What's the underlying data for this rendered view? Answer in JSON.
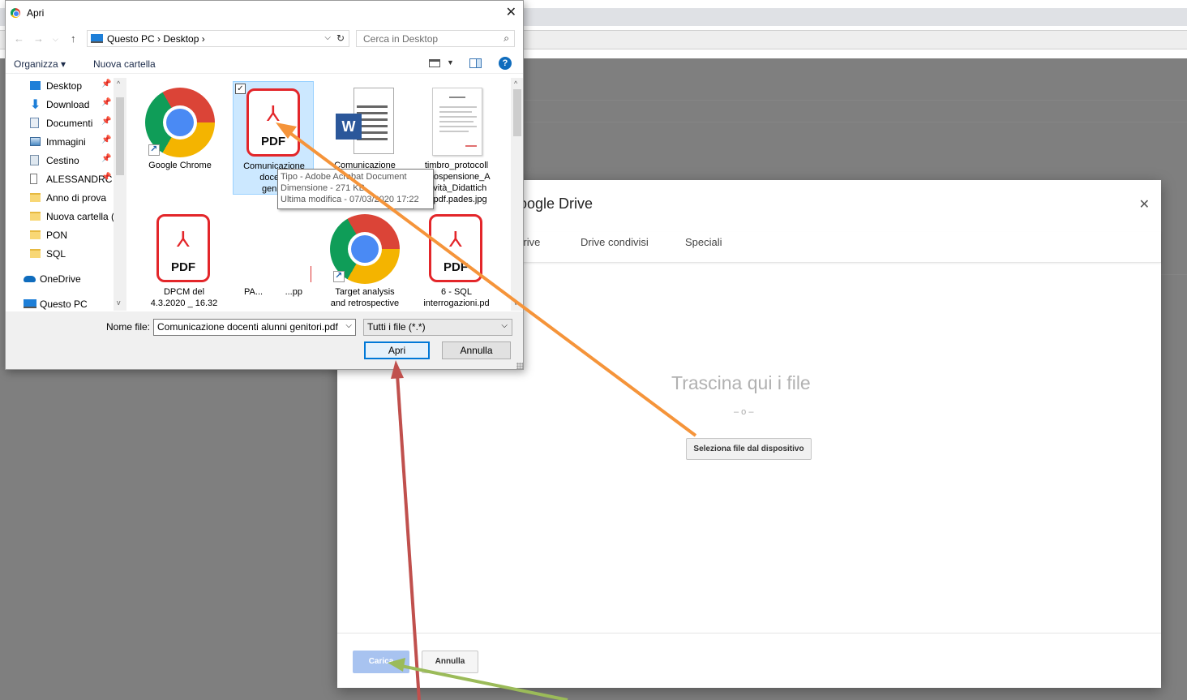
{
  "dialog": {
    "title": "Apri",
    "breadcrumb": "Questo PC  ›  Desktop  ›",
    "search_placeholder": "Cerca in Desktop",
    "toolbar": {
      "organizza": "Organizza ▾",
      "nuova_cartella": "Nuova cartella"
    },
    "nav_items": [
      {
        "label": "Desktop",
        "icon": "desktop-icon",
        "pinned": true
      },
      {
        "label": "Download",
        "icon": "download-icon",
        "pinned": true
      },
      {
        "label": "Documenti",
        "icon": "documents-icon",
        "pinned": true
      },
      {
        "label": "Immagini",
        "icon": "pictures-icon",
        "pinned": true
      },
      {
        "label": "Cestino",
        "icon": "recycle-bin-icon",
        "pinned": true
      },
      {
        "label": "ALESSANDRC",
        "icon": "file-icon",
        "pinned": true
      },
      {
        "label": "Anno di prova",
        "icon": "folder-icon",
        "pinned": false
      },
      {
        "label": "Nuova cartella (3",
        "icon": "folder-icon",
        "pinned": false
      },
      {
        "label": "PON",
        "icon": "folder-icon",
        "pinned": false
      },
      {
        "label": "SQL",
        "icon": "folder-icon",
        "pinned": false
      },
      {
        "label": "OneDrive",
        "icon": "cloud-icon",
        "pinned": false
      },
      {
        "label": "Questo PC",
        "icon": "computer-icon",
        "pinned": false
      }
    ],
    "files": [
      {
        "name": "Google Chrome",
        "type": "chrome-shortcut"
      },
      {
        "name": "Comunicazione docenti alunni genitori.pdf",
        "name_visible": "Comunicazione\ndocenti\ngenito",
        "type": "pdf",
        "selected": true
      },
      {
        "name": "Comunicazione",
        "type": "word"
      },
      {
        "name": "timbro_protocoll\n_Sospensione_A\nttività_Didattich\ne.pdf.pades.jpg",
        "type": "jpg"
      },
      {
        "name": "DPCM del\n4.3.2020 _ 16.32",
        "type": "pdf"
      },
      {
        "name": "PA...         ...pp",
        "type": "blank"
      },
      {
        "name": "Target analysis\nand retrospective",
        "type": "chrome-shortcut"
      },
      {
        "name": "6 - SQL\ninterrogazioni.pd",
        "type": "pdf"
      }
    ],
    "tooltip": {
      "line1": "Tipo - Adobe Acrobat Document",
      "line2": "Dimensione - 271 KB",
      "line3": "Ultima modifica - 07/03/2020 17:22"
    },
    "filename_label": "Nome file:",
    "filename_value": "Comunicazione docenti alunni genitori.pdf",
    "filetype_value": "Tutti i file (*.*)",
    "open_label": "Apri",
    "cancel_label": "Annulla"
  },
  "drive": {
    "title": "Google Drive",
    "tabs": [
      "Drive",
      "Drive condivisi",
      "Speciali"
    ],
    "drop_text": "Trascina qui i file",
    "or_text": "– o –",
    "select_button": "Seleziona file dal dispositivo",
    "upload_button": "Carica",
    "cancel_button": "Annulla"
  },
  "annotations": {
    "arrow_colors": [
      "#f5943a",
      "#c0504d",
      "#9bbb59"
    ]
  }
}
